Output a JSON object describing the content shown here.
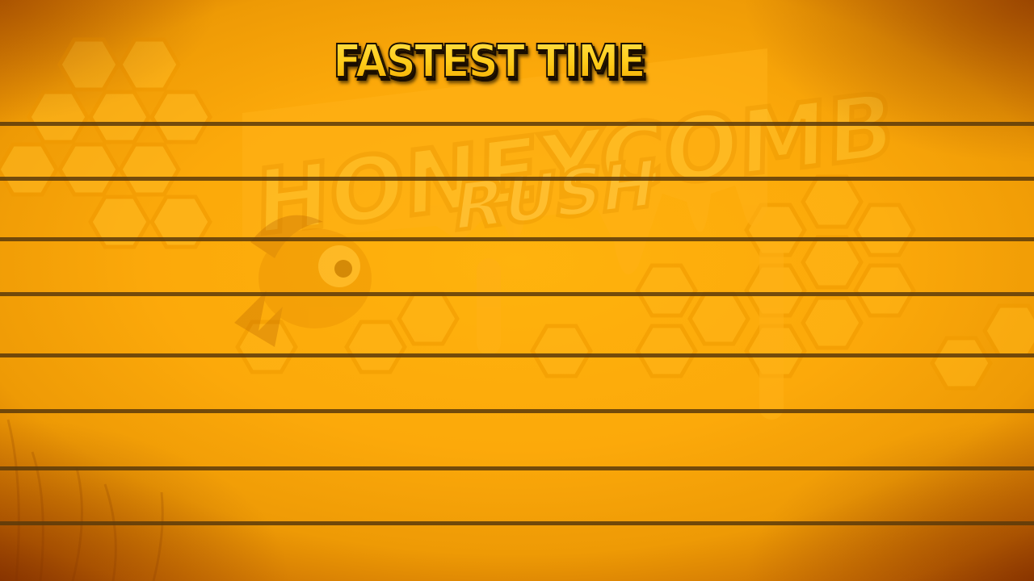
{
  "screen": {
    "title": "FASTEST TIME"
  },
  "background": {
    "logo_text_top": "HONEYCOMB",
    "logo_text_bottom": "RUSH",
    "base_color": "#fca90a",
    "edge_color": "#9a4100",
    "line_color": "#5a3a0a",
    "title_fill": "#ffcc1a",
    "title_outline": "#1a0d00"
  },
  "leaderboard": {
    "rows": [
      {
        "rank": "",
        "name": "",
        "time": ""
      },
      {
        "rank": "",
        "name": "",
        "time": ""
      },
      {
        "rank": "",
        "name": "",
        "time": ""
      },
      {
        "rank": "",
        "name": "",
        "time": ""
      },
      {
        "rank": "",
        "name": "",
        "time": ""
      },
      {
        "rank": "",
        "name": "",
        "time": ""
      },
      {
        "rank": "",
        "name": "",
        "time": ""
      }
    ]
  }
}
